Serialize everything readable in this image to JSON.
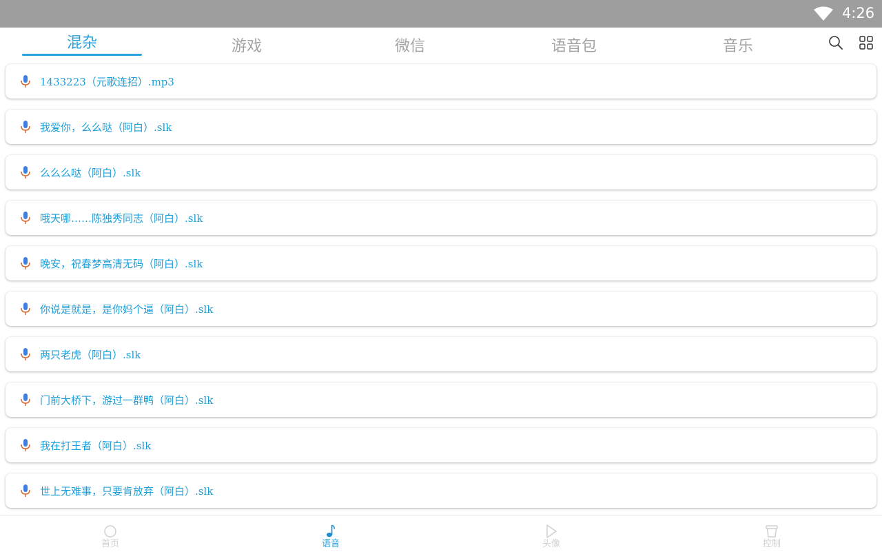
{
  "status_bar": {
    "time": "4:26",
    "wifi_icon": "wifi-icon"
  },
  "tabs": [
    {
      "label": "混杂",
      "active": true
    },
    {
      "label": "游戏",
      "active": false
    },
    {
      "label": "微信",
      "active": false
    },
    {
      "label": "语音包",
      "active": false
    },
    {
      "label": "音乐",
      "active": false
    }
  ],
  "toolbar": {
    "search_icon": "search-icon",
    "grid_icon": "grid-icon"
  },
  "voice_list": [
    {
      "title": "1433223（元歌连招）.mp3",
      "icon": "mic-icon"
    },
    {
      "title": "我爱你，么么哒（阿白）.slk",
      "icon": "mic-icon"
    },
    {
      "title": "么么么哒（阿白）.slk",
      "icon": "mic-icon"
    },
    {
      "title": "哦天哪……陈独秀同志（阿白）.slk",
      "icon": "mic-icon"
    },
    {
      "title": "晚安，祝春梦高清无码（阿白）.slk",
      "icon": "mic-icon"
    },
    {
      "title": "你说是就是，是你妈个逼（阿白）.slk",
      "icon": "mic-icon"
    },
    {
      "title": "两只老虎（阿白）.slk",
      "icon": "mic-icon"
    },
    {
      "title": "门前大桥下，游过一群鸭（阿白）.slk",
      "icon": "mic-icon"
    },
    {
      "title": "我在打王者（阿白）.slk",
      "icon": "mic-icon"
    },
    {
      "title": "世上无难事，只要肯放弃（阿白）.slk",
      "icon": "mic-icon"
    }
  ],
  "bottom_nav": [
    {
      "label": "首页",
      "icon": "home-icon",
      "active": false
    },
    {
      "label": "语音",
      "icon": "music-note-icon",
      "active": true
    },
    {
      "label": "头像",
      "icon": "play-icon",
      "active": false
    },
    {
      "label": "控制",
      "icon": "bucket-icon",
      "active": false
    }
  ],
  "colors": {
    "accent": "#29a2dc",
    "item_text": "#1c9ed8",
    "inactive_tab": "#a4a4a4",
    "inactive_nav": "#d0d0d0",
    "status_bar": "#9e9e9e"
  }
}
